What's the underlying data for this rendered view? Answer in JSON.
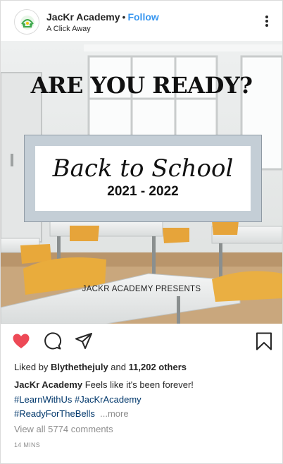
{
  "header": {
    "username": "JacKr Academy",
    "separator": "•",
    "follow_label": "Follow",
    "subtitle": "A Click Away"
  },
  "post_image": {
    "headline": "ARE YOU READY?",
    "script_title": "Back to School",
    "years": "2021 - 2022",
    "presents": "JACKR ACADEMY PRESENTS"
  },
  "actions": {
    "liked": true,
    "like_color": "#ed4956",
    "icons": [
      "heart-icon",
      "comment-icon",
      "share-icon",
      "bookmark-icon"
    ]
  },
  "likes": {
    "prefix": "Liked by",
    "user": "Blythethejuly",
    "and": "and",
    "count": "11,202 others"
  },
  "caption": {
    "username": "JacKr Academy",
    "text": "Feels like it's been forever!",
    "hashtags": [
      "#LearnWithUs",
      "#JacKrAcademy",
      "#ReadyForTheBells"
    ],
    "more_label": "...more"
  },
  "comments_label": "View all 5774 comments",
  "timestamp": "14 MINS",
  "colors": {
    "link": "#3897f0",
    "hashtag": "#00376b",
    "muted": "#8e8e8e"
  }
}
